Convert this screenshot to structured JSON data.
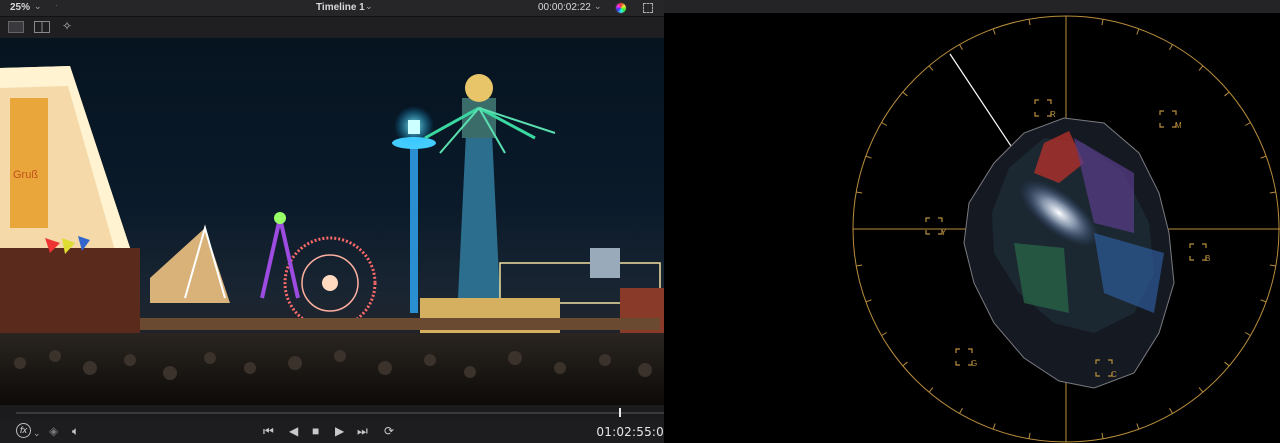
{
  "viewer": {
    "zoom": "25%",
    "timeline_name": "Timeline 1",
    "source_timecode": "00:00:02:22",
    "playhead_timecode": "01:02:55:0",
    "playhead_position": 0.93
  },
  "icons": {
    "zoom_dropdown": "chevron-down-icon",
    "timeline_dropdown": "chevron-down-icon",
    "timecode_dropdown": "chevron-down-icon",
    "color_wheel": "color-wheel-icon",
    "expand": "expand-icon",
    "single_viewer": "single-viewer-icon",
    "split_viewer": "split-viewer-icon",
    "magic_wand": "magic-wand-icon",
    "fx": "fx-icon",
    "layers": "layers-icon",
    "volume": "speaker-icon",
    "skip_back": "skip-to-start-icon",
    "play_reverse": "play-reverse-icon",
    "stop": "stop-icon",
    "play": "play-icon",
    "skip_forward": "skip-to-end-icon",
    "loop": "loop-icon"
  },
  "vectorscope": {
    "targets": [
      "R",
      "M",
      "B",
      "C",
      "G",
      "Y"
    ],
    "colors": {
      "graticule": "#b98e3c",
      "skin_line": "#ffffff"
    }
  }
}
